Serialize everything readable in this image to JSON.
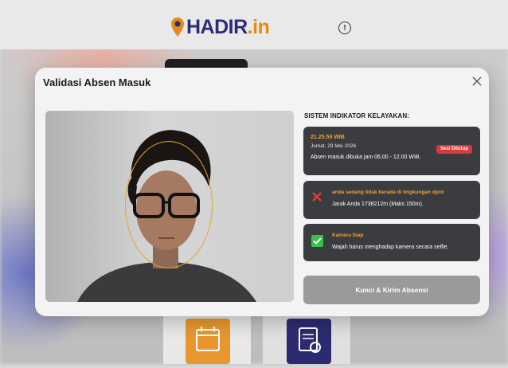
{
  "app": {
    "logo_main": "HADIR",
    "logo_suffix": ".in",
    "info_icon": "info-icon",
    "info_symbol": "!"
  },
  "modal": {
    "title": "Validasi Absen Masuk",
    "close_icon": "close-icon",
    "indicator_title": "SISTEM INDIKATOR KELAYAKAN:",
    "time_panel": {
      "time": "21.25.59 WIB",
      "date": "Jumat, 29 Mei 2026",
      "open_hours": "Absen masuk dibuka jam 06.00 - 12.00 WIB.",
      "status_badge": "Sesi Ditutup"
    },
    "location_panel": {
      "icon": "x-mark-icon",
      "title": "anda sedang tidak berada di lingkungan dprd",
      "distance": "Jarak Anda 1738212m (Maks 150m)."
    },
    "camera_panel": {
      "icon": "check-icon",
      "title": "Kamera Siap",
      "instruction": "Wajah harus menghadap kamera secara selfie."
    },
    "submit_label": "Kunci & Kirim Absensi"
  },
  "colors": {
    "brand_navy": "#2c2b7a",
    "brand_orange": "#e28a1c",
    "panel_dark": "#3a3c40",
    "accent_orange": "#f0a030",
    "danger": "#d83a3a",
    "success": "#3bbf4a",
    "button_disabled": "#9a9a9d"
  }
}
